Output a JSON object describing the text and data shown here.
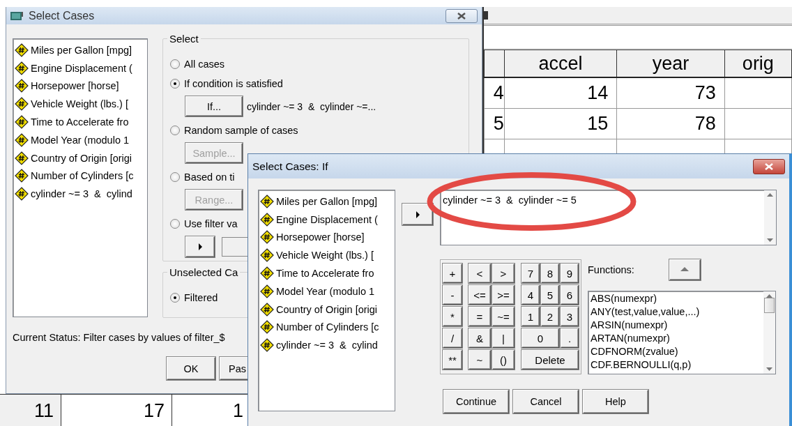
{
  "data_grid": {
    "columns": [
      "",
      "accel",
      "year",
      "orig"
    ],
    "rows": [
      [
        "4",
        "14",
        "73",
        ""
      ],
      [
        "5",
        "15",
        "78",
        ""
      ]
    ],
    "bottom_row": [
      "11",
      "17",
      "1"
    ]
  },
  "select_cases": {
    "title": "Select Cases",
    "variables": [
      "Miles per Gallon [mpg]",
      "Engine Displacement (",
      "Horsepower [horse]",
      "Vehicle Weight (lbs.) [",
      "Time to Accelerate fro",
      "Model Year (modulo 1",
      "Country of Origin [origi",
      "Number of Cylinders [c",
      "cylinder ~= 3  &  cylind"
    ],
    "select_group": {
      "title": "Select",
      "options": [
        {
          "kind": "plain",
          "label": "All cases",
          "selected": false
        },
        {
          "kind": "button",
          "label": "If condition is satisfied",
          "selected": true,
          "button": {
            "label": "If...",
            "disabled": false
          },
          "condition": "cylinder ~= 3  &  cylinder ~=..."
        },
        {
          "kind": "button",
          "label": "Random sample of cases",
          "selected": false,
          "button": {
            "label": "Sample...",
            "disabled": true
          }
        },
        {
          "kind": "button",
          "label": "Based on ti",
          "selected": false,
          "button": {
            "label": "Range...",
            "disabled": true
          }
        },
        {
          "kind": "filter",
          "label": "Use filter va",
          "selected": false
        }
      ]
    },
    "unselected_group": {
      "title": "Unselected Ca",
      "options": [
        {
          "label": "Filtered",
          "selected": true
        }
      ]
    },
    "status": "Current Status: Filter cases by values of filter_$",
    "buttons": [
      "OK",
      "Pas"
    ]
  },
  "if_dialog": {
    "title": "Select Cases: If",
    "variables": [
      "Miles per Gallon [mpg]",
      "Engine Displacement (",
      "Horsepower [horse]",
      "Vehicle Weight (lbs.) [",
      "Time to Accelerate fro",
      "Model Year (modulo 1",
      "Country of Origin [origi",
      "Number of Cylinders [c",
      "cylinder ~= 3  &  cylind"
    ],
    "expression": "cylinder ~= 3  &  cylinder ~= 5",
    "keypad": [
      {
        "operators": [
          "+",
          "<",
          ">"
        ],
        "digits": [
          "7",
          "8",
          "9"
        ]
      },
      {
        "operators": [
          "-",
          "<=",
          ">="
        ],
        "digits": [
          "4",
          "5",
          "6"
        ]
      },
      {
        "operators": [
          "*",
          "=",
          "~="
        ],
        "digits": [
          "1",
          "2",
          "3"
        ]
      },
      {
        "operators": [
          "/",
          "&",
          "|"
        ],
        "digits": [
          "0",
          "."
        ]
      },
      {
        "operators": [
          "**",
          "~",
          "()"
        ],
        "digits": [
          "Delete"
        ]
      }
    ],
    "functions_label": "Functions:",
    "functions": [
      "ABS(numexpr)",
      "ANY(test,value,value,...)",
      "ARSIN(numexpr)",
      "ARTAN(numexpr)",
      "CDFNORM(zvalue)",
      "CDF.BERNOULLI(q,p)"
    ],
    "buttons": [
      "Continue",
      "Cancel",
      "Help"
    ]
  }
}
